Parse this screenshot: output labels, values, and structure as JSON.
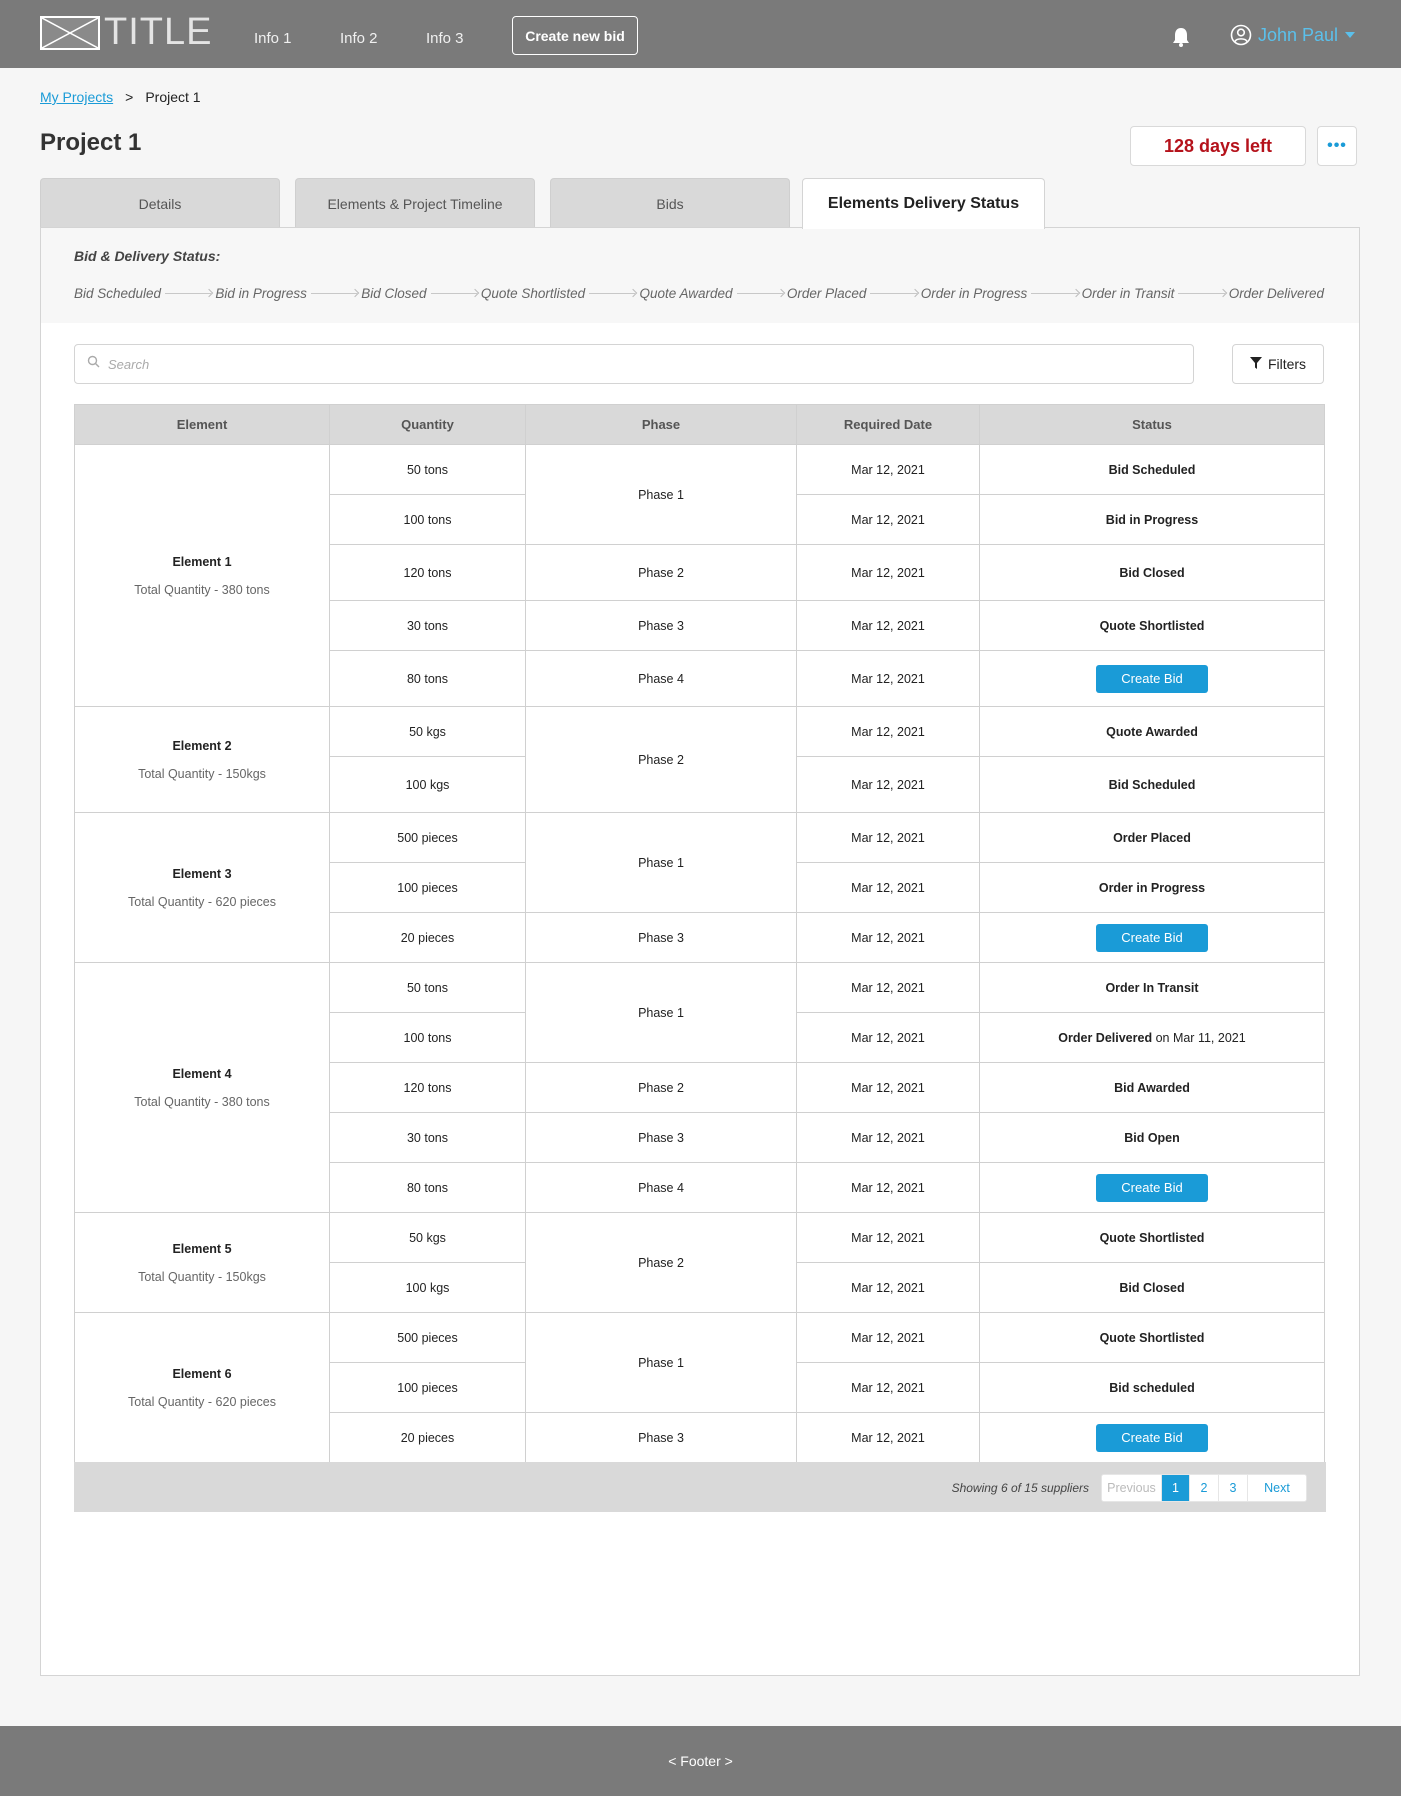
{
  "header": {
    "logo_text": "TITLE",
    "nav": [
      "Info 1",
      "Info 2",
      "Info 3"
    ],
    "create_bid_label": "Create new bid",
    "user_name": "John Paul",
    "icons": {
      "logo": "image-placeholder-icon",
      "bell": "bell-icon",
      "user": "user-circle-icon",
      "caret": "caret-down-icon"
    }
  },
  "breadcrumb": {
    "root": "My Projects",
    "separator": ">",
    "current": "Project 1"
  },
  "page": {
    "title": "Project 1",
    "days_left": "128 days left",
    "more_label": "•••"
  },
  "tabs": [
    {
      "label": "Details",
      "active": false
    },
    {
      "label": "Elements & Project Timeline",
      "active": false
    },
    {
      "label": "Bids",
      "active": false
    },
    {
      "label": "Elements Delivery Status",
      "active": true
    }
  ],
  "status_strip": {
    "title": "Bid & Delivery Status:",
    "steps": [
      "Bid Scheduled",
      "Bid in Progress",
      "Bid Closed",
      "Quote Shortlisted",
      "Quote Awarded",
      "Order Placed",
      "Order in Progress",
      "Order in Transit",
      "Order Delivered"
    ]
  },
  "search": {
    "placeholder": "Search",
    "filters_label": "Filters"
  },
  "table": {
    "columns": [
      "Element",
      "Quantity",
      "Phase",
      "Required Date",
      "Status"
    ],
    "create_bid_label": "Create Bid",
    "elements": [
      {
        "name": "Element 1",
        "total": "Total Quantity - 380 tons",
        "rows": [
          {
            "qty": "50 tons",
            "date": "Mar 12, 2021",
            "status": "Bid Scheduled"
          },
          {
            "qty": "100 tons",
            "date": "Mar 12, 2021",
            "status": "Bid in Progress"
          },
          {
            "qty": "120 tons",
            "date": "Mar 12, 2021",
            "status": "Bid Closed"
          },
          {
            "qty": "30 tons",
            "date": "Mar 12, 2021",
            "status": "Quote Shortlisted"
          },
          {
            "qty": "80 tons",
            "date": "Mar 12, 2021",
            "status": ""
          }
        ],
        "phases": [
          "Phase 1",
          "Phase 2",
          "Phase 3",
          "Phase 4"
        ]
      },
      {
        "name": "Element 2",
        "total": "Total Quantity - 150kgs",
        "rows": [
          {
            "qty": "50 kgs",
            "date": "Mar 12, 2021",
            "status": "Quote Awarded"
          },
          {
            "qty": "100 kgs",
            "date": "Mar 12, 2021",
            "status": "Bid Scheduled"
          }
        ],
        "phases": [
          "Phase 2"
        ]
      },
      {
        "name": "Element 3",
        "total": "Total Quantity - 620 pieces",
        "rows": [
          {
            "qty": "500 pieces",
            "date": "Mar 12, 2021",
            "status": "Order Placed"
          },
          {
            "qty": "100 pieces",
            "date": "Mar 12, 2021",
            "status": "Order in Progress"
          },
          {
            "qty": "20 pieces",
            "date": "Mar 12, 2021",
            "status": ""
          }
        ],
        "phases": [
          "Phase 1",
          "Phase 3"
        ]
      },
      {
        "name": "Element 4",
        "total": "Total Quantity - 380 tons",
        "rows": [
          {
            "qty": "50 tons",
            "date": "Mar 12, 2021",
            "status": "Order In Transit"
          },
          {
            "qty": "100 tons",
            "date": "Mar 12, 2021",
            "status": "Order Delivered",
            "status_suffix": " on Mar 11, 2021"
          },
          {
            "qty": "120 tons",
            "date": "Mar 12, 2021",
            "status": "Bid Awarded"
          },
          {
            "qty": "30 tons",
            "date": "Mar 12, 2021",
            "status": "Bid Open"
          },
          {
            "qty": "80 tons",
            "date": "Mar 12, 2021",
            "status": ""
          }
        ],
        "phases": [
          "Phase 1",
          "Phase 2",
          "Phase 3",
          "Phase 4"
        ]
      },
      {
        "name": "Element 5",
        "total": "Total Quantity - 150kgs",
        "rows": [
          {
            "qty": "50 kgs",
            "date": "Mar 12, 2021",
            "status": "Quote Shortlisted"
          },
          {
            "qty": "100 kgs",
            "date": "Mar 12, 2021",
            "status": "Bid Closed"
          }
        ],
        "phases": [
          "Phase 2"
        ]
      },
      {
        "name": "Element 6",
        "total": "Total Quantity - 620 pieces",
        "rows": [
          {
            "qty": "500 pieces",
            "date": "Mar 12, 2021",
            "status": "Quote Shortlisted"
          },
          {
            "qty": "100 pieces",
            "date": "Mar 12, 2021",
            "status": "Bid scheduled"
          },
          {
            "qty": "20 pieces",
            "date": "Mar 12, 2021",
            "status": ""
          }
        ],
        "phases": [
          "Phase 1",
          "Phase 3"
        ]
      }
    ]
  },
  "pagination": {
    "info": "Showing 6 of 15 suppliers",
    "previous": "Previous",
    "pages": [
      "1",
      "2",
      "3"
    ],
    "current_page": "1",
    "next": "Next"
  },
  "footer": {
    "text": "< Footer >"
  },
  "colors": {
    "header_bg": "#7a7a7a",
    "accent": "#1a9bd7",
    "days_left": "#b5121b",
    "table_header_bg": "#d9d9d9"
  }
}
